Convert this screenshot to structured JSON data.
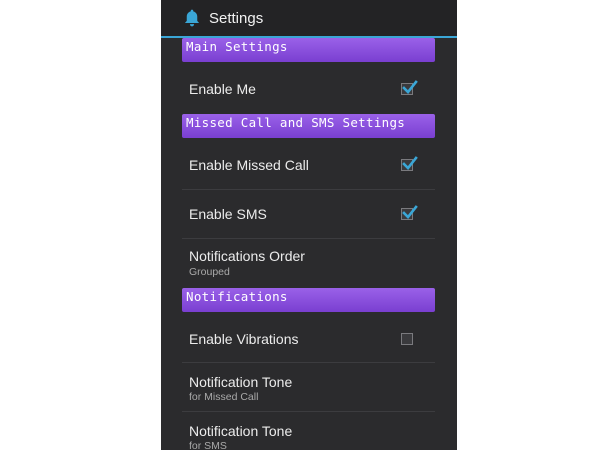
{
  "action_bar": {
    "title": "Settings",
    "icon": "bell-icon"
  },
  "sections": {
    "main": "Main Settings",
    "missed_call_sms": "Missed Call and SMS Settings",
    "notifications": "Notifications"
  },
  "prefs": {
    "enable_me": {
      "title": "Enable Me",
      "checked": true
    },
    "enable_missed_call": {
      "title": "Enable Missed Call",
      "checked": true
    },
    "enable_sms": {
      "title": "Enable SMS",
      "checked": true
    },
    "notifications_order": {
      "title": "Notifications Order",
      "summary": "Grouped"
    },
    "enable_vibrations": {
      "title": "Enable Vibrations",
      "checked": false
    },
    "tone_missed_call": {
      "title": "Notification Tone",
      "summary": "for Missed Call"
    },
    "tone_sms": {
      "title": "Notification Tone",
      "summary": "for SMS"
    }
  },
  "colors": {
    "accent": "#3aa6d6",
    "section_header": "#8a50de",
    "background": "#2b2b2d"
  }
}
